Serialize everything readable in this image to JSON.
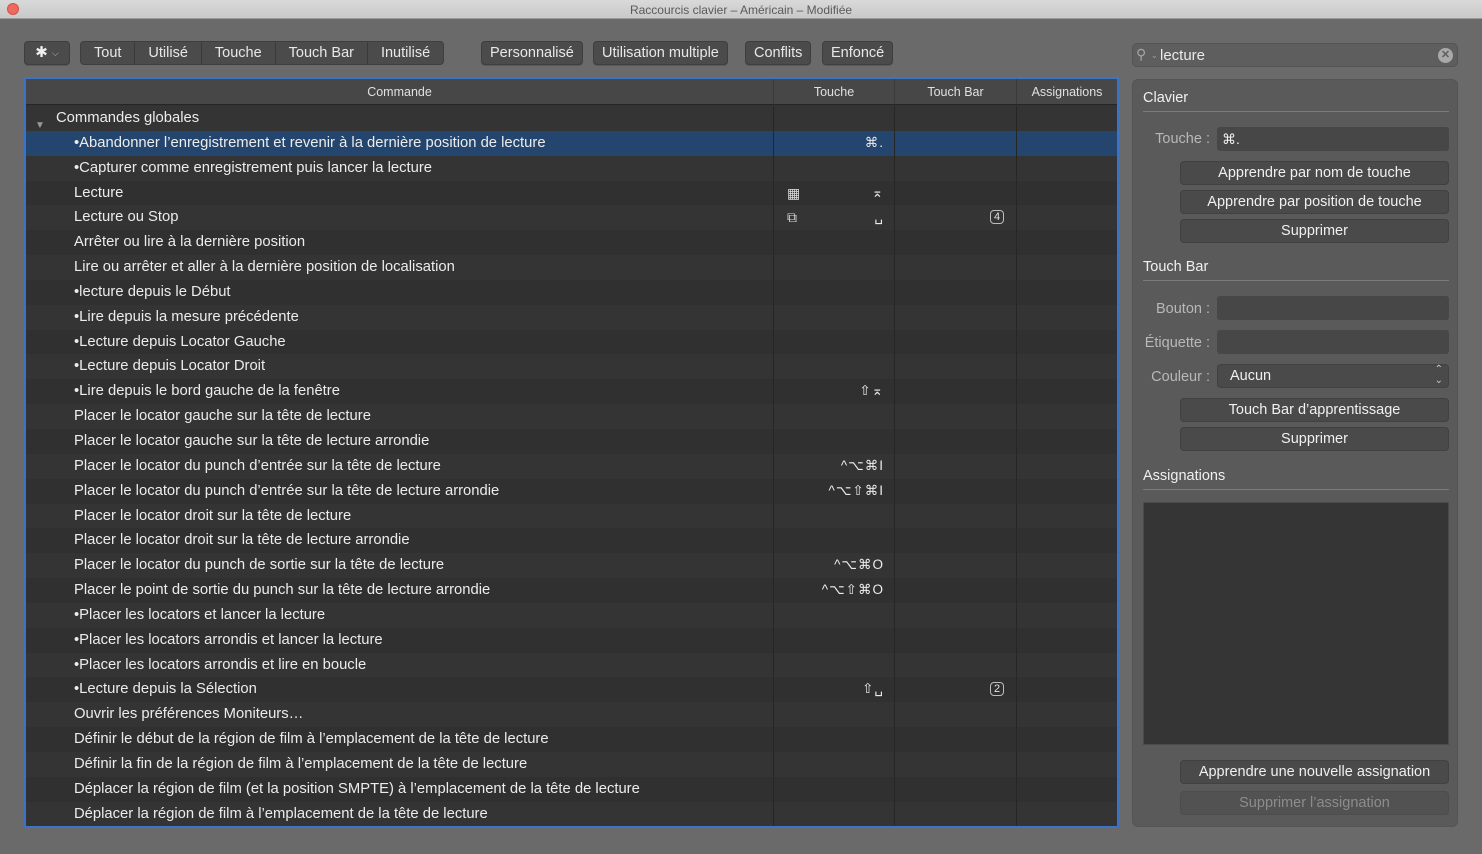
{
  "window": {
    "title": "Raccourcis clavier – Américain – Modifiée"
  },
  "toolbar": {
    "gear_icon": "gear-icon",
    "filters": [
      "Tout",
      "Utilisé",
      "Touche",
      "Touch Bar",
      "Inutilisé"
    ],
    "personnalise": "Personnalisé",
    "utilisation_multiple": "Utilisation multiple",
    "conflits": "Conflits",
    "enfonce": "Enfoncé"
  },
  "search": {
    "value": "lecture",
    "icon": "search-icon",
    "clear_icon": "clear-icon"
  },
  "table": {
    "headers": {
      "command": "Commande",
      "key": "Touche",
      "touchbar": "Touch Bar",
      "assignments": "Assignations"
    },
    "group": "Commandes globales",
    "rows": [
      {
        "command": "•Abandonner l’enregistrement et revenir à la dernière position de lecture",
        "key": "⌘.",
        "key_icon": "",
        "touchbar": "",
        "selected": true
      },
      {
        "command": "•Capturer comme enregistrement puis lancer la lecture",
        "key": "",
        "key_icon": "",
        "touchbar": ""
      },
      {
        "command": "Lecture",
        "key": "⌅",
        "key_icon": "▦",
        "touchbar": ""
      },
      {
        "command": "Lecture ou Stop",
        "key": "␣",
        "key_icon": "⧉",
        "touchbar": "4"
      },
      {
        "command": "Arrêter ou lire à la dernière position",
        "key": "",
        "key_icon": "",
        "touchbar": ""
      },
      {
        "command": "Lire ou arrêter et aller à la dernière position de localisation",
        "key": "",
        "key_icon": "",
        "touchbar": ""
      },
      {
        "command": "•lecture depuis le Début",
        "key": "",
        "key_icon": "",
        "touchbar": ""
      },
      {
        "command": "•Lire depuis la mesure précédente",
        "key": "",
        "key_icon": "",
        "touchbar": ""
      },
      {
        "command": "•Lecture depuis Locator Gauche",
        "key": "",
        "key_icon": "",
        "touchbar": ""
      },
      {
        "command": "•Lecture depuis Locator Droit",
        "key": "",
        "key_icon": "",
        "touchbar": ""
      },
      {
        "command": "•Lire depuis le bord gauche de la fenêtre",
        "key": "⇧⌅",
        "key_icon": "",
        "touchbar": ""
      },
      {
        "command": "Placer le locator gauche sur la tête de lecture",
        "key": "",
        "key_icon": "",
        "touchbar": ""
      },
      {
        "command": "Placer le locator gauche sur la tête de lecture arrondie",
        "key": "",
        "key_icon": "",
        "touchbar": ""
      },
      {
        "command": "Placer le locator du punch d’entrée sur la tête de lecture",
        "key": "^⌥⌘I",
        "key_icon": "",
        "touchbar": ""
      },
      {
        "command": "Placer le locator du punch d’entrée sur la tête de lecture arrondie",
        "key": "^⌥⇧⌘I",
        "key_icon": "",
        "touchbar": ""
      },
      {
        "command": "Placer le locator droit sur la tête de lecture",
        "key": "",
        "key_icon": "",
        "touchbar": ""
      },
      {
        "command": "Placer le locator droit sur la tête de lecture arrondie",
        "key": "",
        "key_icon": "",
        "touchbar": ""
      },
      {
        "command": "Placer le locator du punch de sortie sur la tête de lecture",
        "key": "^⌥⌘O",
        "key_icon": "",
        "touchbar": ""
      },
      {
        "command": "Placer le point de sortie du punch sur la tête de lecture arrondie",
        "key": "^⌥⇧⌘O",
        "key_icon": "",
        "touchbar": ""
      },
      {
        "command": "•Placer les locators et lancer la lecture",
        "key": "",
        "key_icon": "",
        "touchbar": ""
      },
      {
        "command": "•Placer les locators arrondis et lancer la lecture",
        "key": "",
        "key_icon": "",
        "touchbar": ""
      },
      {
        "command": "•Placer les locators arrondis et lire en boucle",
        "key": "",
        "key_icon": "",
        "touchbar": ""
      },
      {
        "command": "•Lecture depuis la Sélection",
        "key": "⇧␣",
        "key_icon": "",
        "touchbar": "2"
      },
      {
        "command": "Ouvrir les préférences Moniteurs…",
        "key": "",
        "key_icon": "",
        "touchbar": ""
      },
      {
        "command": "Définir le début de la région de film à l’emplacement de la tête de lecture",
        "key": "",
        "key_icon": "",
        "touchbar": ""
      },
      {
        "command": "Définir la fin de la région de film à l’emplacement de la tête de lecture",
        "key": "",
        "key_icon": "",
        "touchbar": ""
      },
      {
        "command": "Déplacer la région de film (et la position SMPTE) à l’emplacement de la tête de lecture",
        "key": "",
        "key_icon": "",
        "touchbar": ""
      },
      {
        "command": "Déplacer la région de film à l’emplacement de la tête de lecture",
        "key": "",
        "key_icon": "",
        "touchbar": ""
      }
    ]
  },
  "panel": {
    "clavier": {
      "title": "Clavier",
      "touche_label": "Touche :",
      "touche_value": "⌘.",
      "learn_by_name": "Apprendre par nom de touche",
      "learn_by_position": "Apprendre par position de touche",
      "delete": "Supprimer"
    },
    "touchbar": {
      "title": "Touch Bar",
      "bouton_label": "Bouton :",
      "bouton_value": "",
      "etiquette_label": "Étiquette :",
      "etiquette_value": "",
      "couleur_label": "Couleur :",
      "couleur_value": "Aucun",
      "learn": "Touch Bar d’apprentissage",
      "delete": "Supprimer"
    },
    "assignations": {
      "title": "Assignations",
      "learn_new": "Apprendre une nouvelle assignation",
      "delete": "Supprimer l’assignation"
    }
  }
}
